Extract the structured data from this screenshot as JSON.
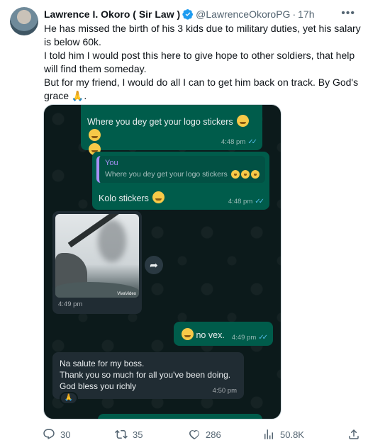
{
  "tweet": {
    "author_name": "Lawrence I. Okoro ( Sir Law )",
    "handle": "@LawrenceOkoroPG",
    "separator": "·",
    "time": "17h",
    "paragraphs": [
      "He has missed the birth of his 3 kids due to military duties, yet his salary is below 60k.",
      "I told him I would post this here to give hope to other soldiers, that help will find them someday.",
      "But for my friend, I would do all I can to get him back on track. By God's grace 🙏."
    ]
  },
  "chat": {
    "msg1": {
      "text": "Where you dey get your logo stickers",
      "time": "4:48 pm"
    },
    "msg2": {
      "quote_author": "You",
      "quote_text": "Where you dey get your logo stickers",
      "text": "Kolo stickers",
      "time": "4:48 pm"
    },
    "photo": {
      "watermark": "VivaVideo",
      "time": "4:49 pm"
    },
    "msg3": {
      "text": "no vex.",
      "time": "4:49 pm"
    },
    "msg4": {
      "lines": [
        "Na salute for my boss.",
        "Thank you so much for all you've been doing.",
        "God bless you richly"
      ],
      "time": "4:50 pm",
      "reaction": "🙏"
    }
  },
  "actions": {
    "replies": "30",
    "reposts": "35",
    "likes": "286",
    "views": "50.8K"
  },
  "colors": {
    "verified": "#1d9bf0",
    "outgoing_bubble": "#005c4b",
    "incoming_bubble": "#202c33",
    "read_ticks": "#53bdeb"
  }
}
